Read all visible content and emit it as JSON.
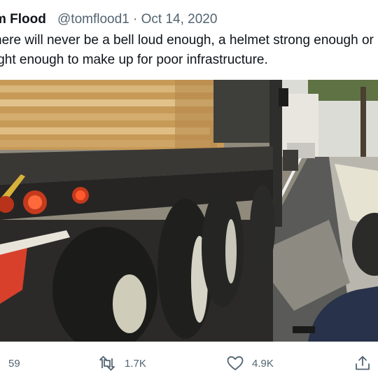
{
  "tweet": {
    "author_name": "m Flood",
    "handle": "@tomflood1",
    "separator": "·",
    "date": "Oct 14, 2020",
    "text_lines": [
      "here will never be a bell loud enough, a helmet strong enough or",
      "ight enough to make up for poor infrastructure."
    ]
  },
  "actions": {
    "reply_count": "59",
    "retweet_count": "1.7K",
    "like_count": "4.9K"
  },
  "icons": {
    "reply": "reply-icon",
    "retweet": "retweet-icon",
    "like": "heart-icon",
    "share": "share-icon"
  },
  "colors": {
    "text": "#0f1419",
    "secondary": "#536471"
  }
}
